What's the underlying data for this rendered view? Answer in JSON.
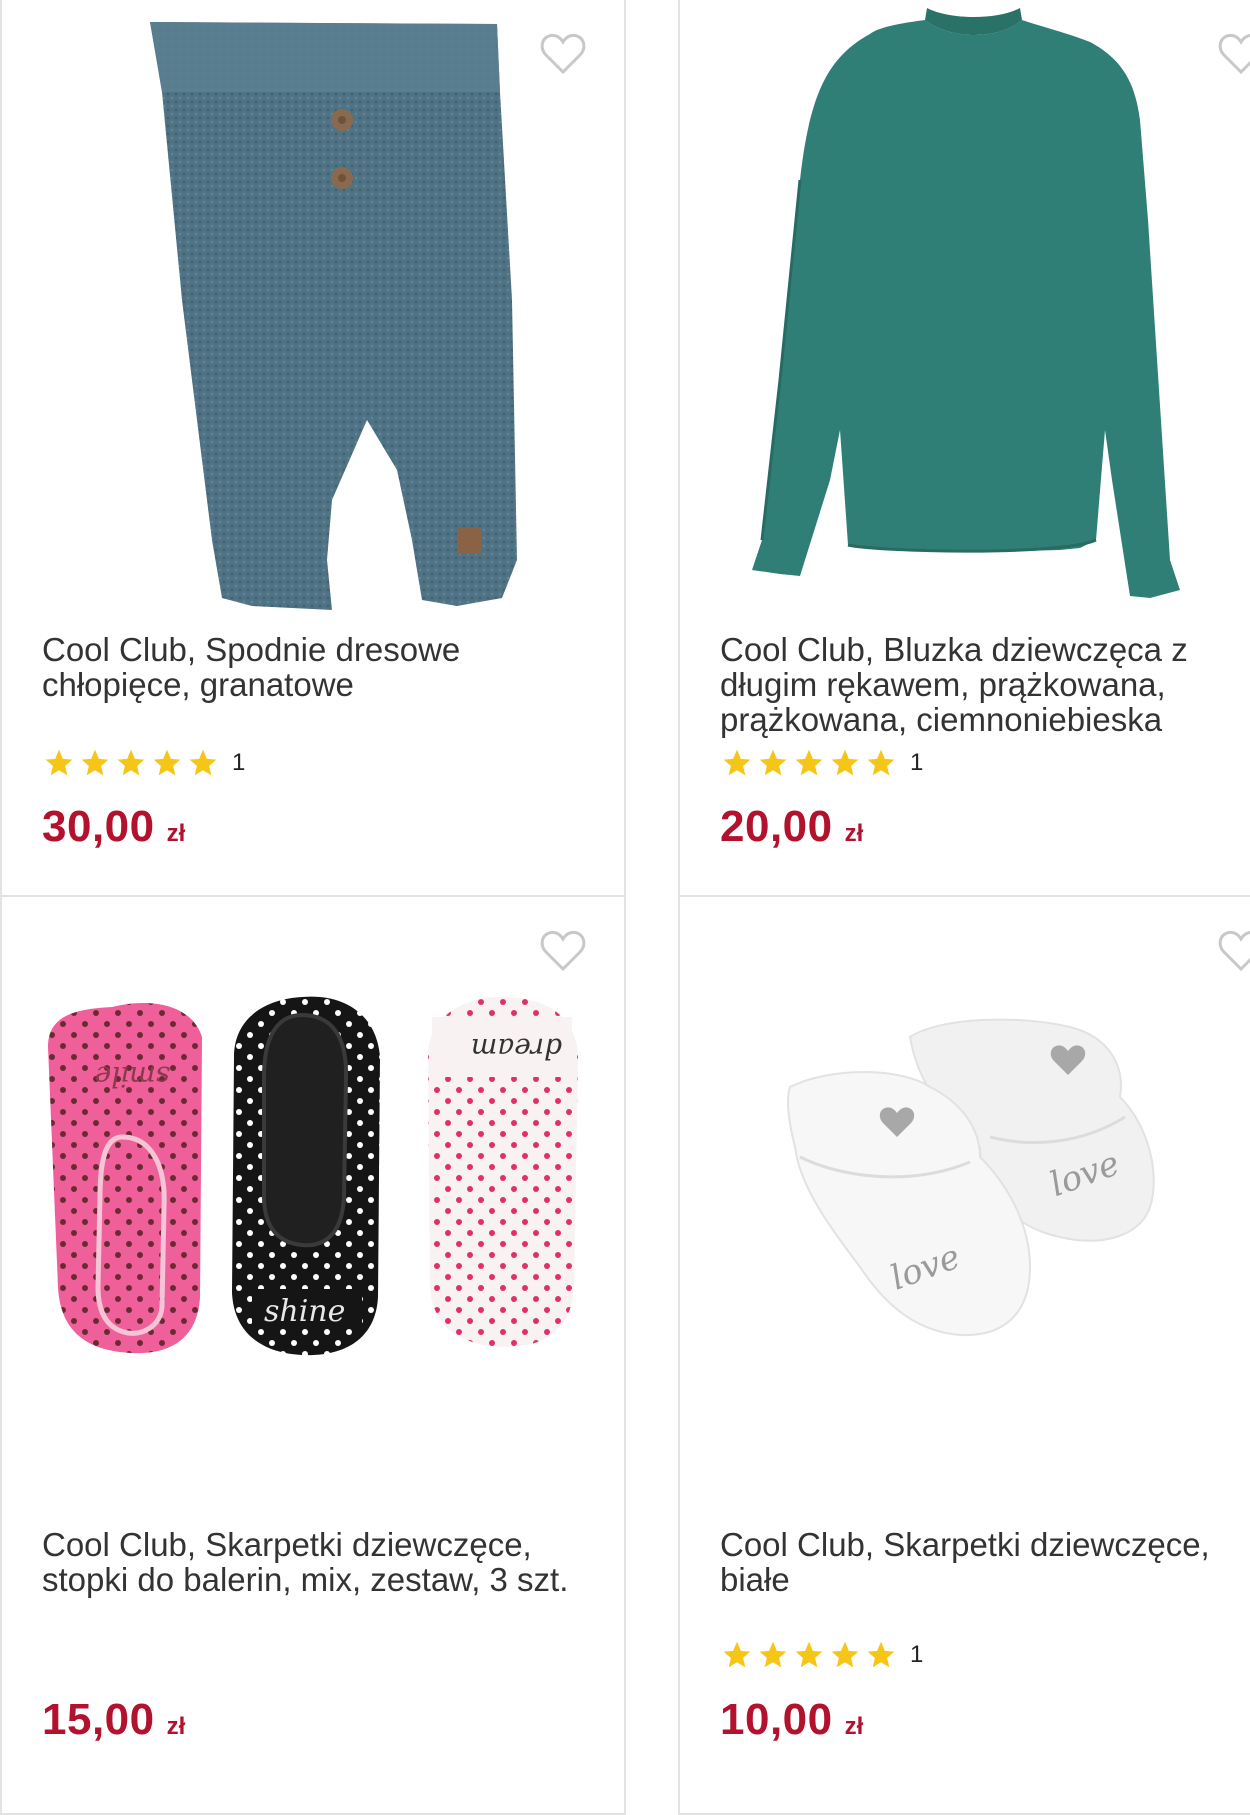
{
  "products": [
    {
      "title_lines": [
        "Cool Club, Spodnie dresowe",
        "chłopięce, granatowe"
      ],
      "rating_count": "1",
      "stars": 5,
      "price": "30,00",
      "currency": "zł",
      "image": "knit-baby-trousers-blue"
    },
    {
      "title_lines": [
        "Cool Club, Bluzka dziewczęca z",
        "długim rękawem, prążkowana,",
        "prążkowana, ciemnoniebieska"
      ],
      "rating_count": "1",
      "stars": 5,
      "price": "20,00",
      "currency": "zł",
      "image": "ribbed-long-sleeve-top-teal"
    },
    {
      "title_lines": [
        "Cool Club, Skarpetki dziewczęce,",
        "stopki do balerin, mix, zestaw, 3 szt."
      ],
      "rating_count": null,
      "stars": 0,
      "price": "15,00",
      "currency": "zł",
      "image": "ballet-liner-socks-3-pack",
      "sock_texts": [
        "smile",
        "shine",
        "dream"
      ]
    },
    {
      "title_lines": [
        "Cool Club, Skarpetki dziewczęce,",
        "białe"
      ],
      "rating_count": "1",
      "stars": 5,
      "price": "10,00",
      "currency": "zł",
      "image": "white-baby-booties-love",
      "sock_texts": [
        "love",
        "love"
      ]
    }
  ],
  "colors": {
    "price": "#b3122f",
    "star": "#f5c518",
    "border": "#e3e3e3"
  },
  "icons": {
    "wishlist": "heart-outline-icon",
    "rating": "star-icon"
  }
}
